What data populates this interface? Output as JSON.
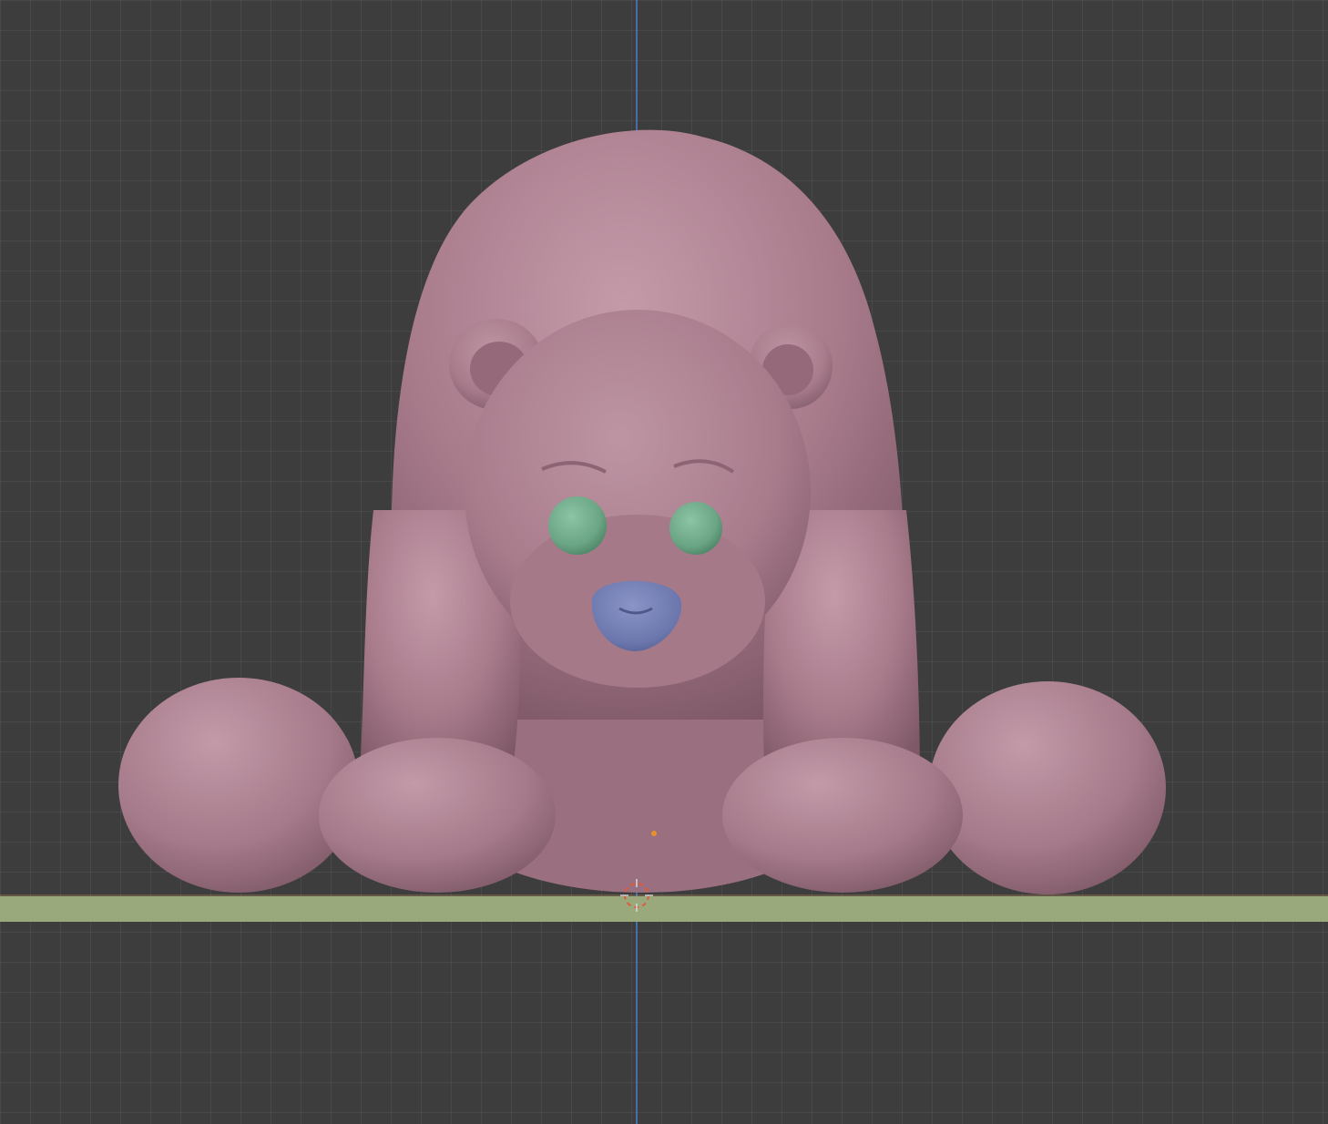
{
  "app": {
    "view": "3D Viewport",
    "background_color": "#3d3d3d",
    "grid_color": "#4a4a4a"
  },
  "axes": {
    "vertical_axis_color": "#4a7fd0",
    "ground_plane_color": "#9aa97c"
  },
  "model": {
    "body_color": "#a97c8c",
    "eye_color": "#6aa585",
    "nose_color": "#6c77ad",
    "icon": "bear-sculpt"
  },
  "markers": {
    "origin_color": "#e8902a",
    "cursor_color": "#d8d8d8",
    "cursor_accent": "#e05a3a"
  }
}
